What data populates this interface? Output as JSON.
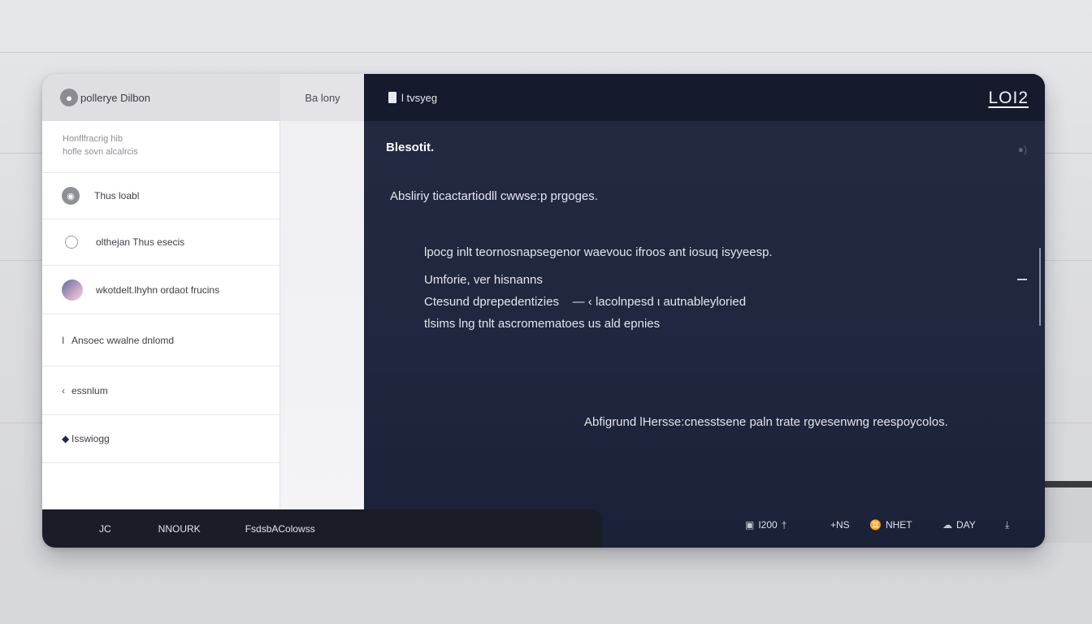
{
  "app": {
    "logo_icon": "user-circle-icon",
    "title": "pollerye Dilbon"
  },
  "sidebar": {
    "sub_line1": "Honflfracrig hib",
    "sub_line2": "hofle sovn alcalrcis",
    "items": [
      {
        "label": "Thus loabl",
        "icon": "avatar-icon"
      },
      {
        "label": "olthejan Thus esecis",
        "icon": "lock-icon"
      },
      {
        "label": "wkotdelt.lhyhn ordaot frucins",
        "icon": "profile-photo-icon"
      },
      {
        "label": "Ansoec wwalne dnlomd",
        "bullet": "I"
      },
      {
        "label": "essnlum",
        "bullet": "‹"
      },
      {
        "label": "Isswiogg",
        "bullet": "◆"
      }
    ]
  },
  "mid": {
    "header": "Ba lony"
  },
  "main": {
    "brand": "l tvsyeg",
    "logo": "LOI2",
    "section_title": "Blesotit.",
    "lead": "Absliriy ticactartiodll cwwse:p prgoges.",
    "para_line1": "lpocg inlt teornosnapsegenor waevouc ifroos ant iosuq isyyeesp.",
    "para_line2": "Umforie, ver hisnanns",
    "para_line3": "Ctesund dprepedentizies    — ‹ lacolnpesd ι autnableyloried",
    "para_line4": "tlsims lng tnlt ascromematoes us ald epnies",
    "footnote": "Abfigrund lHersse:cnesstsene paln trate rgvesenwng reespoycolos."
  },
  "bottom": {
    "item1": "JC",
    "item2": "NNOURK",
    "item3": "FsdsbAColowss"
  },
  "status": {
    "s1_icon": "lock-icon",
    "s1": "I200",
    "s2": "+NS",
    "s3_icon": "person-icon",
    "s3": "NHET",
    "s4_icon": "cloud-icon",
    "s4": "DAY",
    "s5_icon": "download-icon"
  }
}
